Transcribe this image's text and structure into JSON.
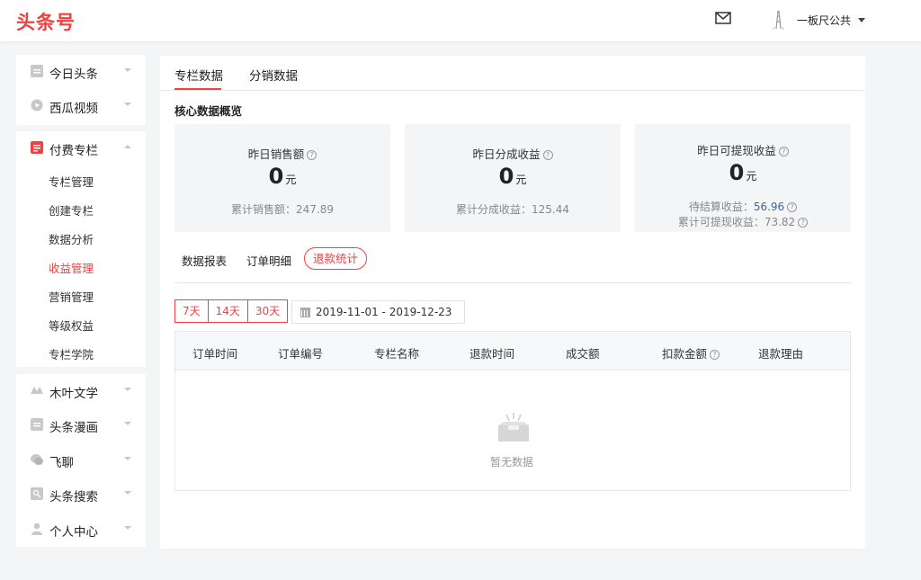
{
  "header": {
    "logo": "头条号",
    "username": "一板尺公共"
  },
  "sidebar": {
    "top_items": [
      {
        "label": "今日头条",
        "icon": "toutiao-icon"
      },
      {
        "label": "西瓜视频",
        "icon": "xigua-icon"
      }
    ],
    "paid_column": {
      "label": "付费专栏",
      "icon": "paid-column-icon",
      "sub_items": [
        "专栏管理",
        "创建专栏",
        "数据分析",
        "收益管理",
        "营销管理",
        "等级权益",
        "专栏学院"
      ],
      "active_sub_item": "收益管理"
    },
    "bottom_items": [
      {
        "label": "木叶文学",
        "icon": "muye-icon"
      },
      {
        "label": "头条漫画",
        "icon": "manhua-icon"
      },
      {
        "label": "飞聊",
        "icon": "feiliao-icon"
      },
      {
        "label": "头条搜索",
        "icon": "search-icon"
      },
      {
        "label": "个人中心",
        "icon": "user-icon"
      }
    ]
  },
  "main": {
    "tabs": [
      "专栏数据",
      "分销数据"
    ],
    "active_tab": "专栏数据",
    "section_title": "核心数据概览",
    "stats": [
      {
        "label": "昨日销售额",
        "value": "0",
        "unit": "元",
        "sub": [
          {
            "label": "累计销售额：",
            "value": "247.89"
          }
        ]
      },
      {
        "label": "昨日分成收益",
        "value": "0",
        "unit": "元",
        "sub": [
          {
            "label": "累计分成收益：",
            "value": "125.44"
          }
        ]
      },
      {
        "label": "昨日可提现收益",
        "value": "0",
        "unit": "元",
        "sub": [
          {
            "label": "待结算收益：",
            "value": "56.96"
          },
          {
            "label": "累计可提现收益：",
            "value": "73.82"
          }
        ]
      }
    ],
    "subtabs": [
      "数据报表",
      "订单明细",
      "退款统计"
    ],
    "active_subtab": "退款统计",
    "range_buttons": [
      "7天",
      "14天",
      "30天"
    ],
    "date_range": "2019-11-01 - 2019-12-23",
    "table_headers": [
      "订单时间",
      "订单编号",
      "专栏名称",
      "退款时间",
      "成交额",
      "扣款金额",
      "退款理由"
    ],
    "empty_text": "暂无数据"
  },
  "colors": {
    "brand": "#f04142",
    "link_blue": "#406599",
    "page_bg": "#f4f5f6"
  }
}
